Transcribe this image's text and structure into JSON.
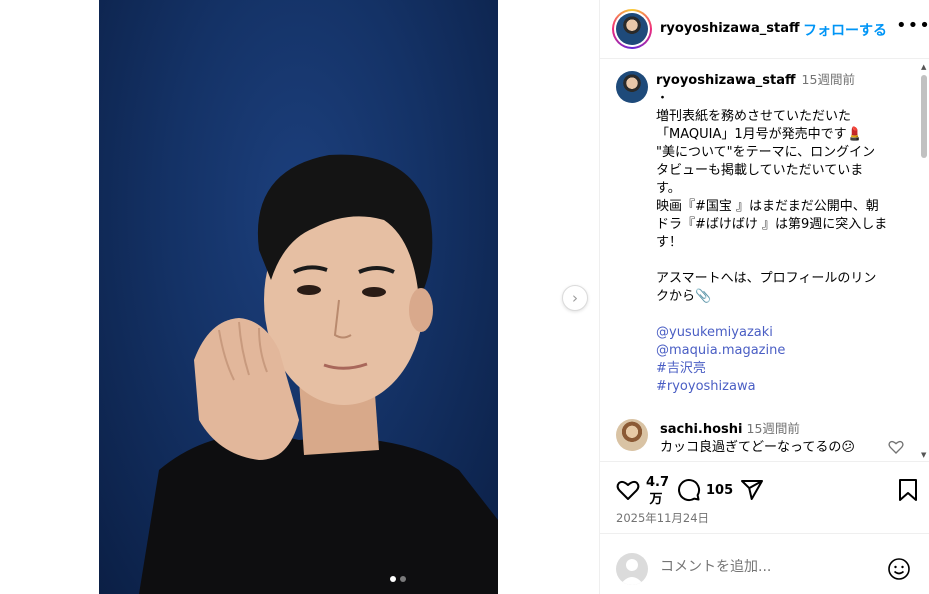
{
  "post": {
    "carousel": {
      "current_index": 0,
      "total": 2
    }
  },
  "header": {
    "username": "ryoyoshizawa_staff",
    "follow_label": "フォローする",
    "more_label": "•••"
  },
  "caption": {
    "username": "ryoyoshizawa_staff",
    "time": "15週間前",
    "lines": [
      "・",
      "増刊表紙を務めさせていただいた",
      "「MAQUIA」1月号が発売中です💄",
      "\"美について\"をテーマに、ロングイン",
      "タビューも掲載していただいていま",
      "す。",
      "映画『#国宝 』はまだまだ公開中、朝",
      "ドラ『#ばけばけ 』は第9週に突入しま",
      "す！",
      "",
      "アスマートへは、プロフィールのリン",
      "クから📎",
      "",
      "@yusukemiyazaki",
      "@maquia.magazine",
      "#吉沢亮",
      "#ryoyoshizawa"
    ]
  },
  "comment": {
    "username": "sachi.hoshi",
    "time": "15週間前",
    "text": "カッコ良過ぎてどーなってるの😕"
  },
  "actions": {
    "likes": "4.7\n万",
    "likes_line1": "4.7",
    "likes_line2": "万",
    "comments": "105",
    "date": "2025年11月24日"
  },
  "add_comment": {
    "placeholder": "コメントを追加..."
  },
  "icons": [
    "heart-icon",
    "comment-icon",
    "share-icon",
    "save-icon",
    "emoji-icon",
    "chevron-right-icon",
    "more-icon"
  ],
  "colors": {
    "follow": "#0095f6",
    "link": "#4a5ec4",
    "photo_bg": "#143266"
  }
}
